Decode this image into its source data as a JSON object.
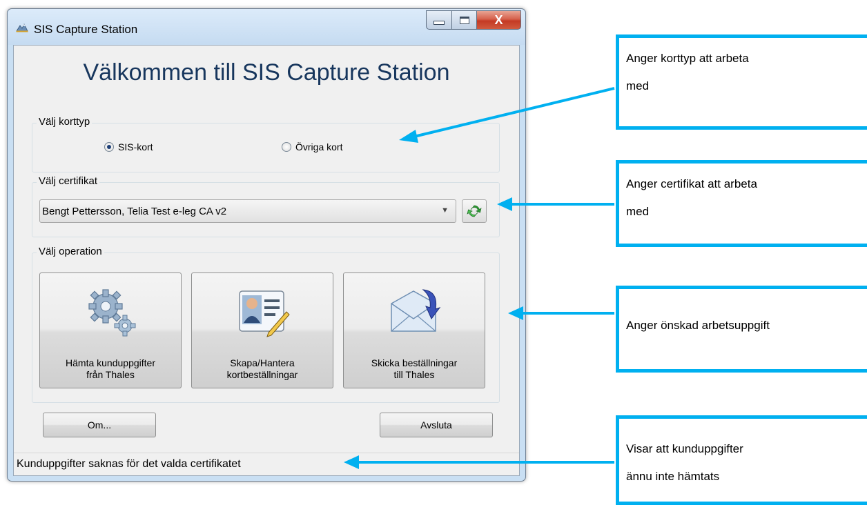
{
  "window": {
    "title": "SIS Capture Station",
    "close_label": "X"
  },
  "main": {
    "welcome": "Välkommen till SIS Capture Station",
    "card_type": {
      "label": "Välj korttyp",
      "options": [
        {
          "label": "SIS-kort",
          "checked": true
        },
        {
          "label": "Övriga kort",
          "checked": false
        }
      ]
    },
    "certificate": {
      "label": "Välj certifikat",
      "selected": "Bengt Pettersson, Telia Test e-leg CA v2"
    },
    "operation": {
      "label": "Välj operation",
      "buttons": [
        {
          "line1": "Hämta kunduppgifter",
          "line2": "från Thales",
          "icon": "gears-icon"
        },
        {
          "line1": "Skapa/Hantera",
          "line2": "kortbeställningar",
          "icon": "id-card-edit-icon"
        },
        {
          "line1": "Skicka beställningar",
          "line2": "till Thales",
          "icon": "send-mail-icon"
        }
      ]
    },
    "om_label": "Om...",
    "avsluta_label": "Avsluta"
  },
  "status": {
    "text": "Kunduppgifter saknas för det valda certifikatet"
  },
  "callouts": [
    {
      "line1": "Anger korttyp att arbeta",
      "line2": "med"
    },
    {
      "line1": "Anger certifikat att arbeta",
      "line2": "med"
    },
    {
      "line1": "Anger önskad arbetsuppgift",
      "line2": ""
    },
    {
      "line1": "Visar att kunduppgifter",
      "line2": "ännu inte hämtats"
    }
  ],
  "colors": {
    "callout_border": "#00b0f0",
    "title_text": "#17365d"
  }
}
